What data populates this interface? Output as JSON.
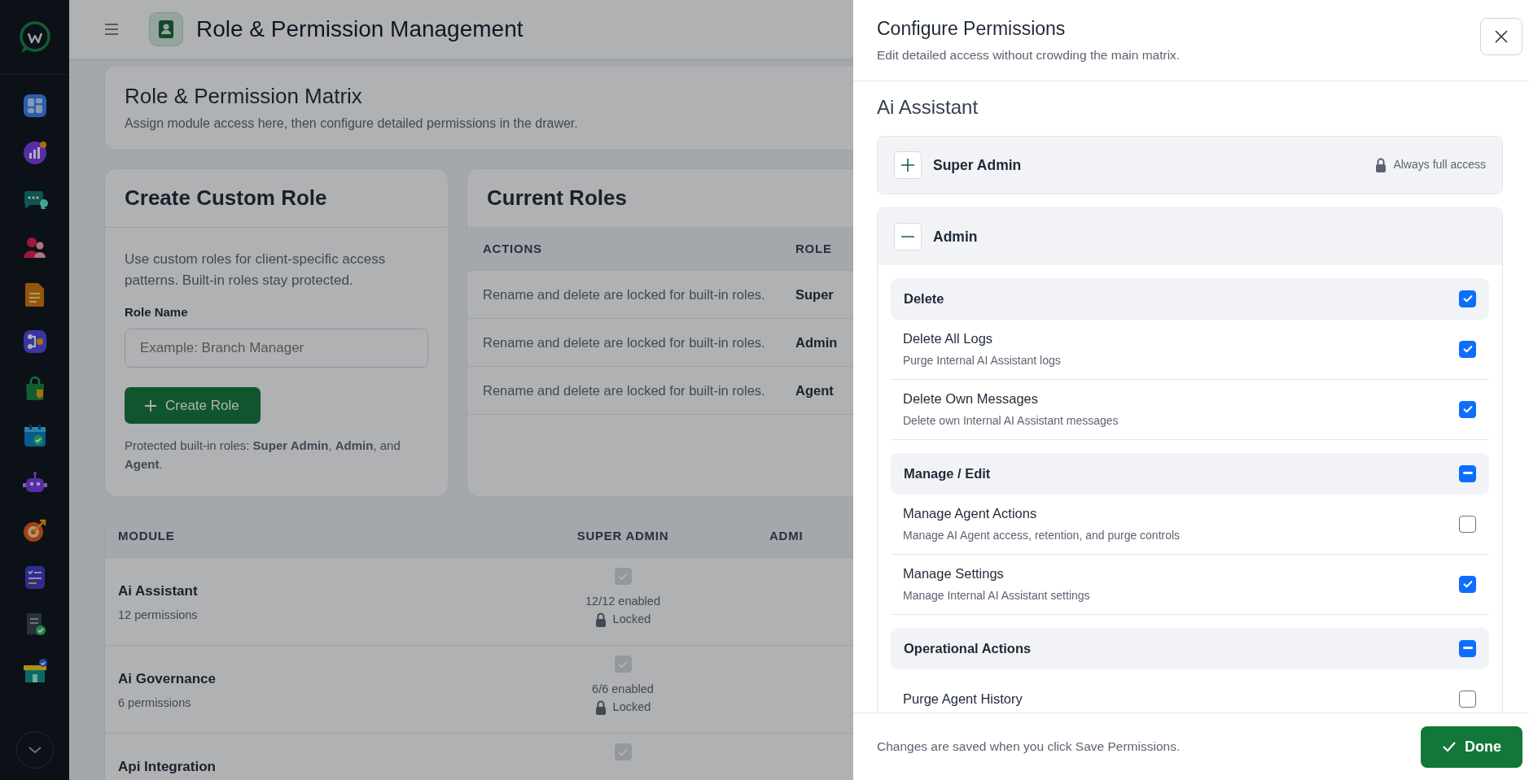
{
  "header": {
    "title": "Role & Permission Management"
  },
  "matrix_card": {
    "title": "Role & Permission Matrix",
    "subtitle": "Assign module access here, then configure detailed permissions in the drawer."
  },
  "create_role": {
    "title": "Create Custom Role",
    "description": "Use custom roles for client-specific access patterns. Built-in roles stay protected.",
    "field_label": "Role Name",
    "placeholder": "Example: Branch Manager",
    "button": "Create Role",
    "note": "Protected built-in roles: **Super Admin**, **Admin**, and **Agent**."
  },
  "current_roles": {
    "title": "Current Roles",
    "columns": [
      "ACTIONS",
      "ROLE"
    ],
    "rows": [
      {
        "actions": "Rename and delete are locked for built-in roles.",
        "role": "Super"
      },
      {
        "actions": "Rename and delete are locked for built-in roles.",
        "role": "Admin"
      },
      {
        "actions": "Rename and delete are locked for built-in roles.",
        "role": "Agent"
      }
    ]
  },
  "module_table": {
    "columns": [
      "MODULE",
      "SUPER ADMIN",
      "ADMI"
    ],
    "rows": [
      {
        "name": "Ai Assistant",
        "count": "12 permissions",
        "super_admin": {
          "checked": true,
          "enabled": "12/12 enabled",
          "locked": "Locked"
        }
      },
      {
        "name": "Ai Governance",
        "count": "6 permissions",
        "super_admin": {
          "checked": true,
          "enabled": "6/6 enabled",
          "locked": "Locked"
        }
      },
      {
        "name": "Api Integration",
        "super_admin": {
          "checked": true
        }
      }
    ]
  },
  "drawer": {
    "title": "Configure Permissions",
    "subtitle": "Edit detailed access without crowding the main matrix.",
    "module": "Ai Assistant",
    "roles": [
      {
        "name": "Super Admin",
        "expanded": false,
        "note": "Always full access"
      },
      {
        "name": "Admin",
        "expanded": true,
        "groups": [
          {
            "label": "Delete",
            "checked": true,
            "permissions": [
              {
                "name": "Delete All Logs",
                "description": "Purge Internal AI Assistant logs",
                "checked": true
              },
              {
                "name": "Delete Own Messages",
                "description": "Delete own Internal AI Assistant messages",
                "checked": true
              }
            ]
          },
          {
            "label": "Manage / Edit",
            "indeterminate": true,
            "permissions": [
              {
                "name": "Manage Agent Actions",
                "description": "Manage AI Agent access, retention, and purge controls",
                "checked": false
              },
              {
                "name": "Manage Settings",
                "description": "Manage Internal AI Assistant settings",
                "checked": true
              }
            ]
          },
          {
            "label": "Operational Actions",
            "indeterminate": true,
            "permissions": [
              {
                "name": "Purge Agent History",
                "checked": false
              }
            ]
          }
        ]
      }
    ],
    "footer": "Changes are saved when you click Save Permissions.",
    "done_button": "Done"
  }
}
